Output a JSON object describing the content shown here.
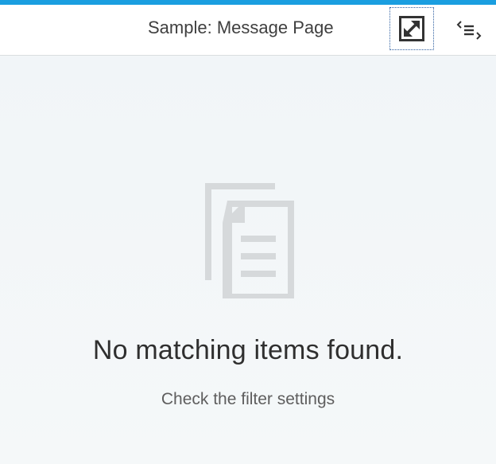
{
  "header": {
    "title": "Sample: Message Page",
    "fullscreen_icon": "fullscreen-expand-icon",
    "source_icon": "view-source-icon"
  },
  "message_page": {
    "icon": "documents-icon",
    "title": "No matching items found.",
    "description": "Check the filter settings"
  },
  "colors": {
    "accent": "#1a9ee0",
    "icon_gray": "#d6d9db",
    "focus_outline": "#2f5fa0"
  }
}
